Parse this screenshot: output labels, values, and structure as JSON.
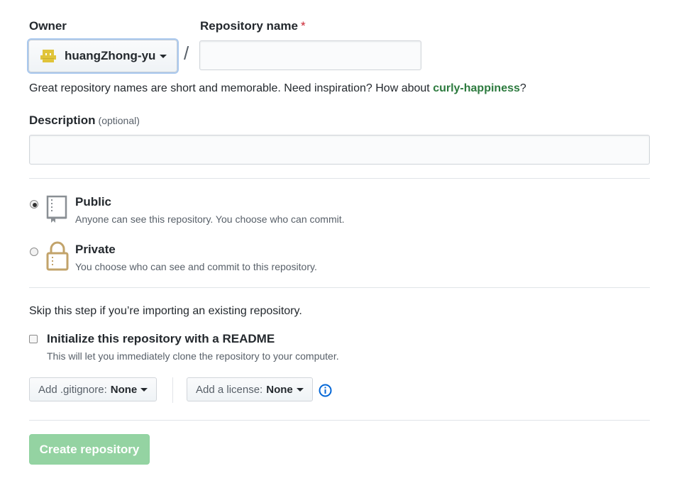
{
  "owner": {
    "label": "Owner",
    "value": "huangZhong-yu"
  },
  "repo_name": {
    "label": "Repository name",
    "required_mark": "*",
    "value": "",
    "separator": "/"
  },
  "hint": {
    "prefix": "Great repository names are short and memorable. Need inspiration? How about ",
    "suggestion": "curly-happiness",
    "suffix": "?"
  },
  "description": {
    "label": "Description",
    "optional": "(optional)",
    "value": ""
  },
  "visibility": {
    "public": {
      "title": "Public",
      "desc": "Anyone can see this repository. You choose who can commit.",
      "selected": true
    },
    "private": {
      "title": "Private",
      "desc": "You choose who can see and commit to this repository.",
      "selected": false
    }
  },
  "init": {
    "skip_text": "Skip this step if you’re importing an existing repository.",
    "readme_label": "Initialize this repository with a README",
    "readme_desc": "This will let you immediately clone the repository to your computer.",
    "readme_checked": false
  },
  "gitignore": {
    "label": "Add .gitignore:",
    "value": "None"
  },
  "license": {
    "label": "Add a license:",
    "value": "None"
  },
  "create_button": "Create repository",
  "colors": {
    "accent_link": "#2c7a3e",
    "create_button": "#94d3a2",
    "info_icon": "#0366d6"
  }
}
